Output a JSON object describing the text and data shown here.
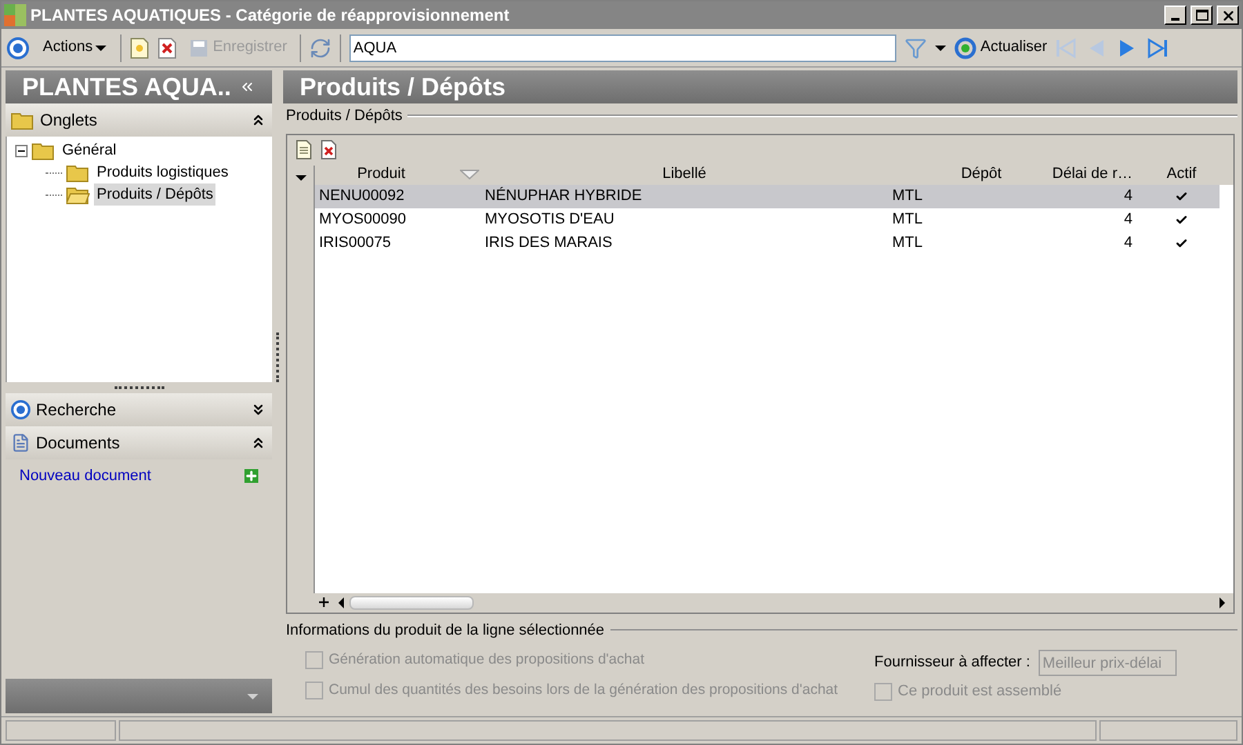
{
  "window": {
    "title": "PLANTES AQUATIQUES - Catégorie de réapprovisionnement"
  },
  "toolbar": {
    "actions": "Actions",
    "save": {
      "label": "Enregistrer",
      "disabled": true
    },
    "search": {
      "value": "AQUA"
    },
    "refresh": "Actualiser",
    "nav": [
      {
        "kind": "first",
        "disabled": true
      },
      {
        "kind": "prev",
        "disabled": true
      },
      {
        "kind": "next",
        "disabled": false
      },
      {
        "kind": "last",
        "disabled": false
      }
    ]
  },
  "sidebar": {
    "title": "PLANTES AQUA..",
    "sections": [
      {
        "kind": "tree",
        "title": "Onglets",
        "expanded": true,
        "tree": [
          {
            "label": "Général",
            "expanded": true,
            "selected": false,
            "children": [
              {
                "label": "Produits logistiques",
                "selected": false
              },
              {
                "label": "Produits / Dépôts",
                "selected": true
              }
            ]
          }
        ]
      },
      {
        "kind": "search",
        "title": "Recherche",
        "expanded": false
      },
      {
        "kind": "docs",
        "title": "Documents",
        "expanded": true,
        "link": "Nouveau document"
      }
    ]
  },
  "main": {
    "title": "Produits / Dépôts",
    "group": "Produits / Dépôts",
    "table": {
      "columns": [
        "Produit",
        "Libellé",
        "Dépôt",
        "Délai de r…",
        "Actif"
      ],
      "rows": [
        {
          "cells": [
            "NENU00092",
            "NÉNUPHAR HYBRIDE",
            "MTL",
            "4"
          ],
          "active": true,
          "selected": true
        },
        {
          "cells": [
            "MYOS00090",
            "MYOSOTIS D'EAU",
            "MTL",
            "4"
          ],
          "active": true,
          "selected": false
        },
        {
          "cells": [
            "IRIS00075",
            "IRIS DES MARAIS",
            "MTL",
            "4"
          ],
          "active": true,
          "selected": false
        }
      ]
    },
    "info": {
      "title": "Informations du produit de la ligne sélectionnée",
      "options": [
        {
          "label": "Génération automatique des propositions d'achat",
          "checked": false,
          "disabled": true
        },
        {
          "label": "Cumul des quantités des besoins lors de la génération des propositions d'achat",
          "checked": false,
          "disabled": true
        }
      ],
      "supplier_label": "Fournisseur à affecter :",
      "supplier_value": "Meilleur prix-délai",
      "assembled": {
        "label": "Ce produit est assemblé",
        "checked": false,
        "disabled": true
      }
    }
  }
}
